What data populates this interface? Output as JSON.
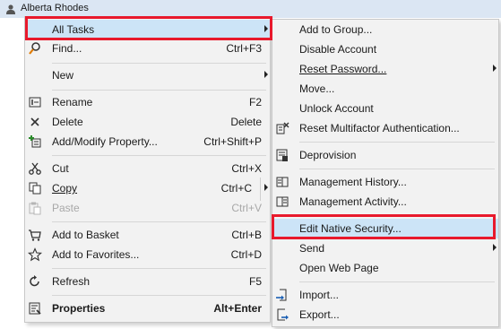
{
  "header": {
    "user": "Alberta Rhodes"
  },
  "main_menu": {
    "all_tasks": "All Tasks",
    "find": {
      "label": "Find...",
      "shortcut": "Ctrl+F3"
    },
    "new": "New",
    "rename": {
      "label": "Rename",
      "shortcut": "F2"
    },
    "delete": {
      "label": "Delete",
      "shortcut": "Delete"
    },
    "add_modify_property": {
      "label": "Add/Modify Property...",
      "shortcut": "Ctrl+Shift+P"
    },
    "cut": {
      "label": "Cut",
      "shortcut": "Ctrl+X"
    },
    "copy": {
      "label": "Copy",
      "shortcut": "Ctrl+C"
    },
    "paste": {
      "label": "Paste",
      "shortcut": "Ctrl+V"
    },
    "add_to_basket": {
      "label": "Add to Basket",
      "shortcut": "Ctrl+B"
    },
    "add_to_favorites": {
      "label": "Add to Favorites...",
      "shortcut": "Ctrl+D"
    },
    "refresh": {
      "label": "Refresh",
      "shortcut": "F5"
    },
    "properties": {
      "label": "Properties",
      "shortcut": "Alt+Enter"
    }
  },
  "submenu": {
    "add_to_group": "Add to Group...",
    "disable_account": "Disable Account",
    "reset_password": "Reset Password...",
    "move": "Move...",
    "unlock_account": "Unlock Account",
    "reset_mfa": "Reset Multifactor Authentication...",
    "deprovision": "Deprovision",
    "management_history": "Management History...",
    "management_activity": "Management Activity...",
    "edit_native_security": "Edit Native Security...",
    "send": "Send",
    "open_web_page": "Open Web Page",
    "import": "Import...",
    "export": "Export..."
  }
}
